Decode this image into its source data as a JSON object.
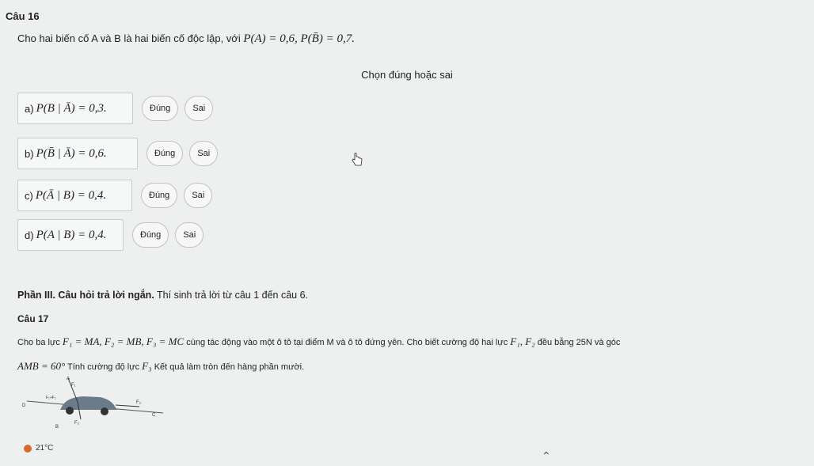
{
  "q16": {
    "title": "Câu 16",
    "intro": "Cho hai biến cố A và B là hai biến cố độc lập, với",
    "given": "P(A) = 0,6, P(B̄) = 0,7."
  },
  "prompt": "Chọn đúng hoặc sai",
  "options": [
    {
      "label": "a)",
      "math": "P(B | Ā) = 0,3.",
      "true_label": "Đúng",
      "false_label": "Sai"
    },
    {
      "label": "b)",
      "math": "P(B̄ | Ā) = 0,6.",
      "true_label": "Đúng",
      "false_label": "Sai"
    },
    {
      "label": "c)",
      "math": "P(Ā | B) = 0,4.",
      "true_label": "Đúng",
      "false_label": "Sai"
    },
    {
      "label": "d)",
      "math": "P(A | B) = 0,4.",
      "true_label": "Đúng",
      "false_label": "Sai"
    }
  ],
  "part3": {
    "heading": "Phần III. Câu hỏi trả lời ngắn.",
    "text": "Thí sinh trả lời từ câu 1 đến câu 6."
  },
  "q17": {
    "title": "Câu 17",
    "line1_a": "Cho ba lực",
    "line1_vectors": "F₁ = MA, F₂ = MB, F₃ = MC",
    "line1_b": "cùng tác động vào một ô tô tại điểm M và ô tô đứng yên. Cho biết cường độ hai lực",
    "line1_c": "F₁, F₂",
    "line1_d": "đều bằng 25N và góc",
    "line2_angle": "AMB = 60°",
    "line2_a": "Tính cường độ lực",
    "line2_vec": "F₃",
    "line2_b": "Kết quả làm tròn đến hàng phần mười."
  },
  "figure": {
    "A": "A",
    "B": "B",
    "C": "C",
    "D": "D",
    "f1": "F₁",
    "f2": "F₂",
    "f3": "F₃",
    "f12": "F₁+F₂"
  },
  "taskbar": {
    "temperature": "21°C"
  }
}
